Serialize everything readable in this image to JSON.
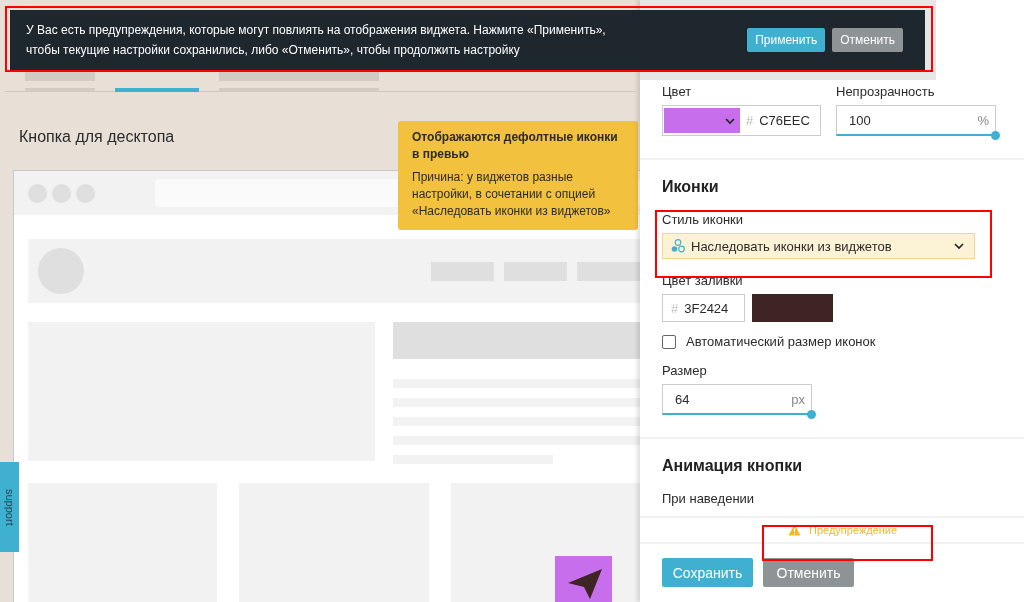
{
  "notice": {
    "text": "У Вас есть предупреждения, которые могут повлиять на отображения виджета. Нажмите «Применить», чтобы текущие настройки сохранились, либо «Отменить», чтобы продолжить настройку",
    "buttons": [
      {
        "label": "Применить",
        "kind": "primary"
      },
      {
        "label": "Отменить",
        "kind": "secondary"
      }
    ]
  },
  "tabs": [
    {
      "selected": false
    },
    {
      "selected": true
    },
    {
      "selected": false
    }
  ],
  "preview": {
    "title": "Кнопка для десктопа"
  },
  "tooltip": {
    "title": "Отображаются дефолтные иконки в превью",
    "text": "Причина: у виджетов разные настройки, в сочетании с опцией «Наследовать иконки из виджетов»"
  },
  "support_tab": {
    "label": "support"
  },
  "settings": {
    "color": {
      "label": "Цвет",
      "hash": "#",
      "value": "C76EEC"
    },
    "opacity": {
      "label": "Непрозрачность",
      "value": "100",
      "unit": "%"
    },
    "icons": {
      "heading": "Иконки",
      "style_label": "Стиль иконки",
      "style_value": "Наследовать иконки из виджетов",
      "fill_label": "Цвет заливки",
      "fill_hash": "#",
      "fill_value": "3F2424",
      "auto_size": {
        "label": "Автоматический размер иконок",
        "checked": false
      },
      "size_label": "Размер",
      "size_value": "64",
      "size_unit": "px"
    },
    "animation": {
      "heading": "Анимация кнопки",
      "hover_label": "При наведении"
    }
  },
  "warning": {
    "label": "Предупреждение"
  },
  "footer_buttons": [
    {
      "label": "Сохранить",
      "kind": "primary"
    },
    {
      "label": "Отменить",
      "kind": "secondary"
    }
  ]
}
